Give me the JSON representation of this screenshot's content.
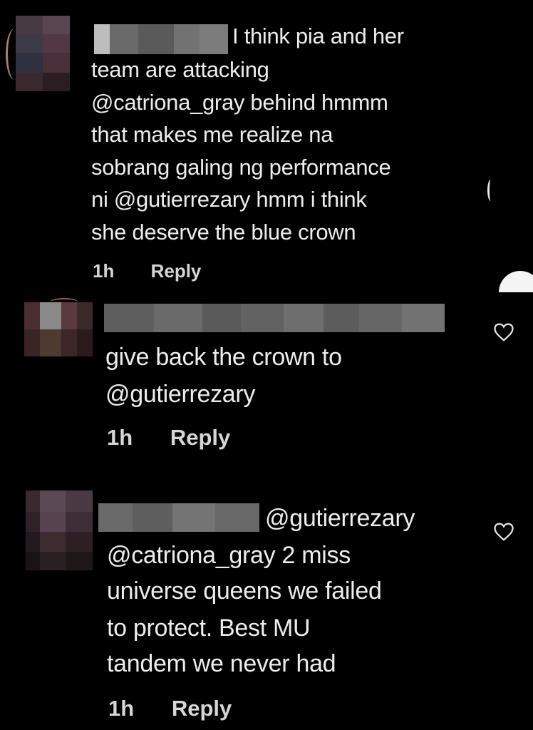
{
  "comments": [
    {
      "username_redacted": true,
      "text_lines": [
        "I think pia and her",
        "team are attacking",
        "@catriona_gray behind hmmm",
        "that makes me realize na",
        "sobrang galing ng performance",
        "ni @gutierrezary hmm i think",
        "she deserve the blue crown"
      ],
      "time": "1h",
      "reply_label": "Reply"
    },
    {
      "username_redacted": true,
      "text_lines": [
        "give back the crown to",
        "@gutierrezary"
      ],
      "time": "1h",
      "reply_label": "Reply",
      "like_icon": "heart-outline-icon"
    },
    {
      "username_redacted": true,
      "text_lines": [
        "@gutierrezary",
        "@catriona_gray 2 miss",
        "universe queens we failed",
        "to protect. Best MU",
        "tandem we never had"
      ],
      "time": "1h",
      "reply_label": "Reply",
      "like_icon": "heart-outline-icon"
    }
  ],
  "colors": {
    "background": "#000000",
    "text": "#ededed",
    "meta_text": "#d6d6d6",
    "redaction": "#5a5a5a"
  }
}
